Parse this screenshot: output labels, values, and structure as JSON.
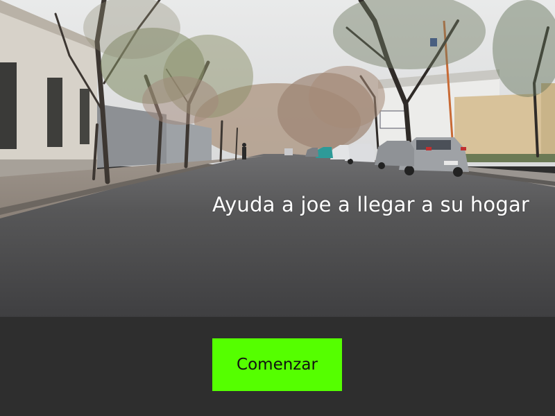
{
  "scene": {
    "caption": "Ayuda a joe a llegar a su hogar",
    "caption_color": "#ffffff",
    "description_icon": "street-photo"
  },
  "controls": {
    "start_label": "Comenzar",
    "start_color": "#55ff00",
    "bar_color": "#2e2e2e"
  }
}
